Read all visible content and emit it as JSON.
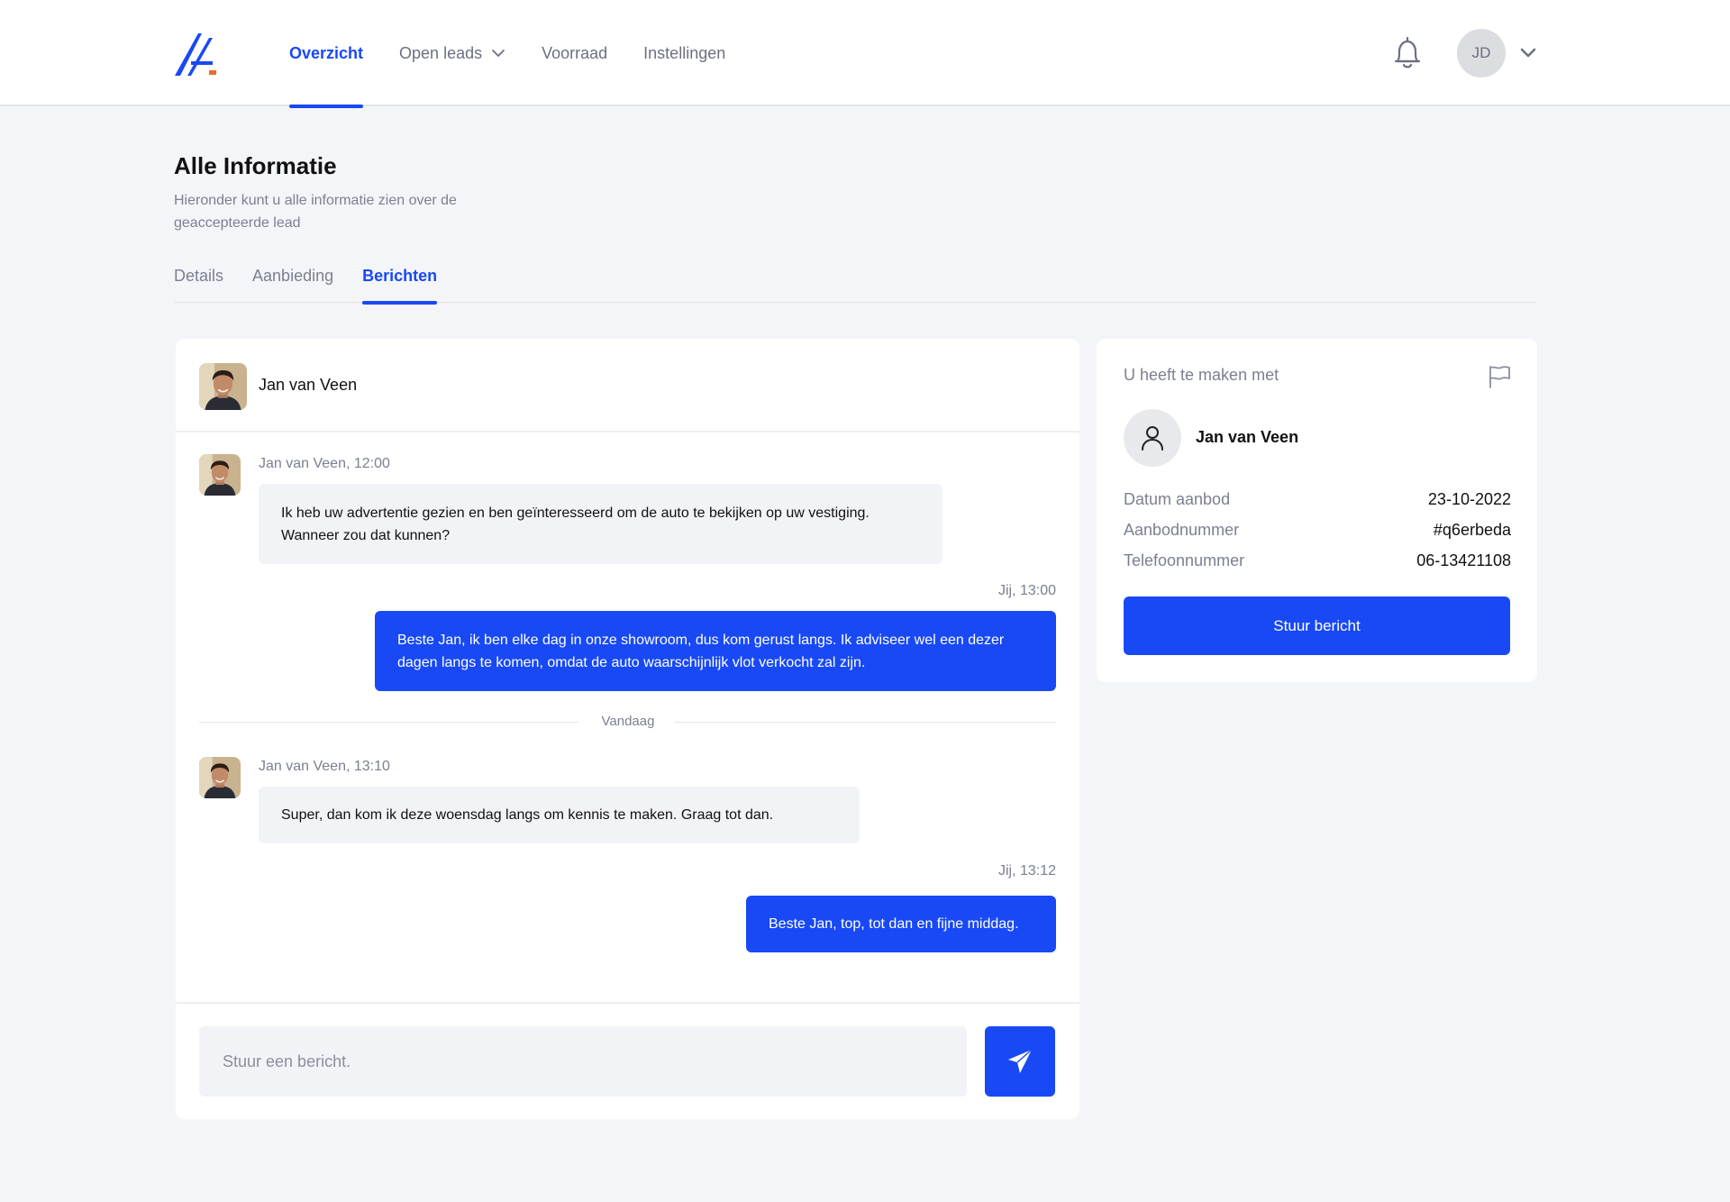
{
  "header": {
    "nav": [
      {
        "label": "Overzicht",
        "active": true
      },
      {
        "label": "Open leads",
        "active": false
      },
      {
        "label": "Voorraad",
        "active": false
      },
      {
        "label": "Instellingen",
        "active": false
      }
    ],
    "user_initials": "JD",
    "icons": [
      "logo-icon",
      "chevron-down-icon",
      "bell-icon",
      "chevron-down-icon"
    ]
  },
  "page": {
    "title": "Alle Informatie",
    "subtitle": "Hieronder kunt u alle informatie zien over de geaccepteerde lead"
  },
  "tabs": [
    {
      "label": "Details",
      "active": false
    },
    {
      "label": "Aanbieding",
      "active": false
    },
    {
      "label": "Berichten",
      "active": true
    }
  ],
  "chat": {
    "contact_name": "Jan van Veen",
    "messages": [
      {
        "direction": "in",
        "meta": "Jan van Veen, 12:00",
        "text": "Ik heb uw advertentie gezien en ben geïnteresseerd om de auto te bekijken op uw vestiging. Wanneer zou dat kunnen?"
      },
      {
        "direction": "out",
        "meta": "Jij, 13:00",
        "text": "Beste Jan, ik ben elke dag in onze showroom, dus kom gerust langs. Ik adviseer wel een dezer dagen langs te komen, omdat de auto waarschijnlijk vlot verkocht zal zijn."
      },
      {
        "direction": "in",
        "meta": "Jan van Veen, 13:10",
        "text": "Super, dan kom ik deze woensdag langs om kennis te maken. Graag tot dan."
      },
      {
        "direction": "out",
        "meta": "Jij, 13:12",
        "text": "Beste Jan, top, tot dan en fijne middag."
      }
    ],
    "day_divider": "Vandaag",
    "composer_placeholder": "Stuur een bericht."
  },
  "info": {
    "heading": "U heeft te maken met",
    "name": "Jan van Veen",
    "rows": [
      {
        "label": "Datum aanbod",
        "value": "23-10-2022"
      },
      {
        "label": "Aanbodnummer",
        "value": "#q6erbeda"
      },
      {
        "label": "Telefoonnummer",
        "value": "06-13421108"
      }
    ],
    "button_label": "Stuur bericht"
  },
  "colors": {
    "accent": "#1849f5",
    "logo_accent": "#f26a2e",
    "page_bg": "#f4f5f8"
  }
}
